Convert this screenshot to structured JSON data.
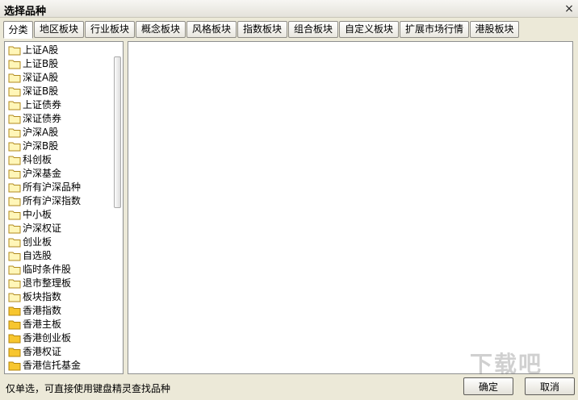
{
  "window": {
    "title": "选择品种",
    "close": "×"
  },
  "tabs": [
    {
      "label": "分类",
      "active": true
    },
    {
      "label": "地区板块"
    },
    {
      "label": "行业板块"
    },
    {
      "label": "概念板块"
    },
    {
      "label": "风格板块"
    },
    {
      "label": "指数板块"
    },
    {
      "label": "组合板块"
    },
    {
      "label": "自定义板块"
    },
    {
      "label": "扩展市场行情"
    },
    {
      "label": "港股板块"
    }
  ],
  "tree": [
    {
      "label": "上证A股",
      "icon": "folder-icon"
    },
    {
      "label": "上证B股",
      "icon": "folder-icon"
    },
    {
      "label": "深证A股",
      "icon": "folder-icon"
    },
    {
      "label": "深证B股",
      "icon": "folder-icon"
    },
    {
      "label": "上证债券",
      "icon": "folder-icon"
    },
    {
      "label": "深证债券",
      "icon": "folder-icon"
    },
    {
      "label": "沪深A股",
      "icon": "folder-icon"
    },
    {
      "label": "沪深B股",
      "icon": "folder-icon"
    },
    {
      "label": "科创板",
      "icon": "folder-icon"
    },
    {
      "label": "沪深基金",
      "icon": "folder-icon"
    },
    {
      "label": "所有沪深品种",
      "icon": "folder-icon"
    },
    {
      "label": "所有沪深指数",
      "icon": "folder-icon"
    },
    {
      "label": "中小板",
      "icon": "folder-icon"
    },
    {
      "label": "沪深权证",
      "icon": "folder-icon"
    },
    {
      "label": "创业板",
      "icon": "folder-icon"
    },
    {
      "label": "自选股",
      "icon": "folder-icon"
    },
    {
      "label": "临时条件股",
      "icon": "folder-icon"
    },
    {
      "label": "退市整理板",
      "icon": "folder-icon"
    },
    {
      "label": "板块指数",
      "icon": "folder-icon"
    },
    {
      "label": "香港指数",
      "icon": "folder-filled-icon"
    },
    {
      "label": "香港主板",
      "icon": "folder-filled-icon"
    },
    {
      "label": "香港创业板",
      "icon": "folder-filled-icon"
    },
    {
      "label": "香港权证",
      "icon": "folder-filled-icon"
    },
    {
      "label": "香港信托基金",
      "icon": "folder-filled-icon"
    }
  ],
  "status": {
    "hint": "仅单选，可直接使用键盘精灵查找品种"
  },
  "buttons": {
    "ok": "确定",
    "cancel": "取消"
  },
  "watermark": "下载吧"
}
